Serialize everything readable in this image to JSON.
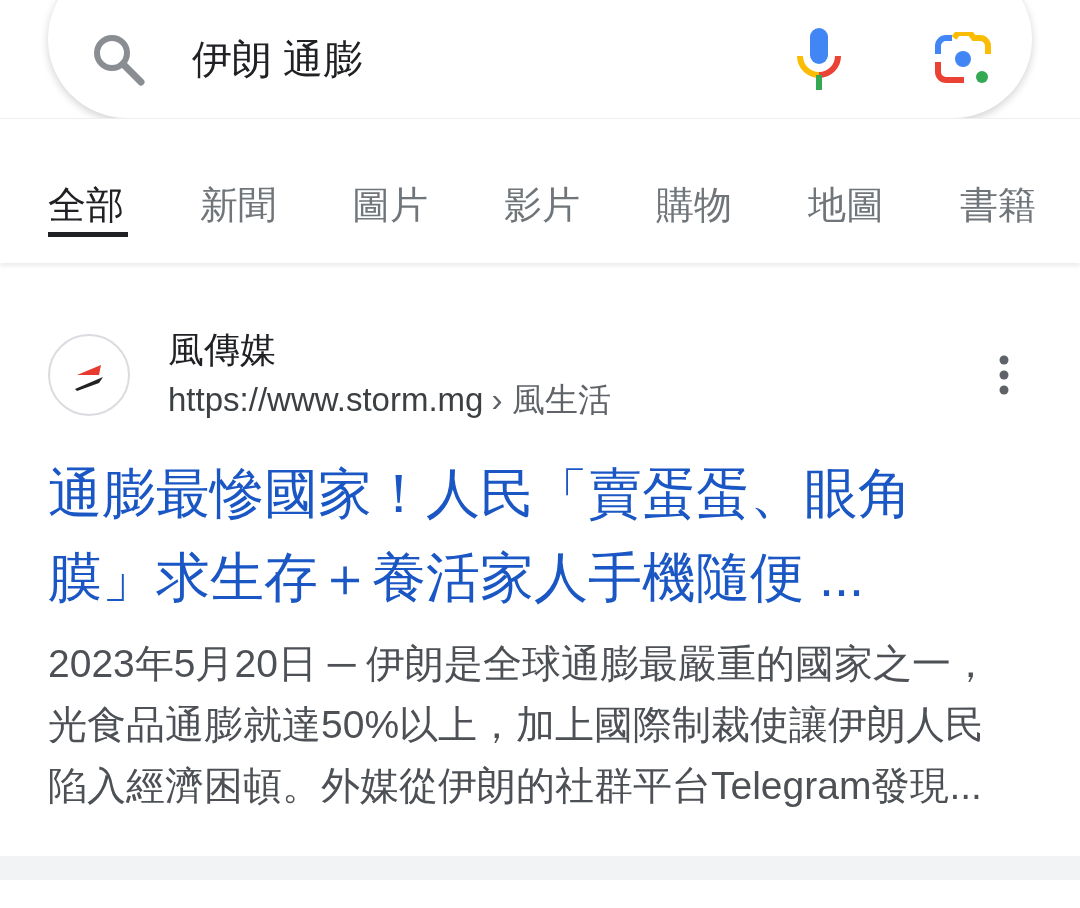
{
  "search": {
    "query": "伊朗 通膨"
  },
  "tabs": [
    {
      "label": "全部",
      "selected": true
    },
    {
      "label": "新聞",
      "selected": false
    },
    {
      "label": "圖片",
      "selected": false
    },
    {
      "label": "影片",
      "selected": false
    },
    {
      "label": "購物",
      "selected": false
    },
    {
      "label": "地圖",
      "selected": false
    },
    {
      "label": "書籍",
      "selected": false
    }
  ],
  "result": {
    "site_name": "風傳媒",
    "url": "https://www.storm.mg",
    "breadcrumb": "› 風生活",
    "title": "通膨最慘國家！人民「賣蛋蛋、眼角膜」求生存＋養活家人手機隨便 ...",
    "snippet": "2023年5月20日 ─ 伊朗是全球通膨最嚴重的國家之一，光食品通膨就達50%以上，加上國際制裁使讓伊朗人民陷入經濟困頓。外媒從伊朗的社群平台Telegram發現..."
  }
}
